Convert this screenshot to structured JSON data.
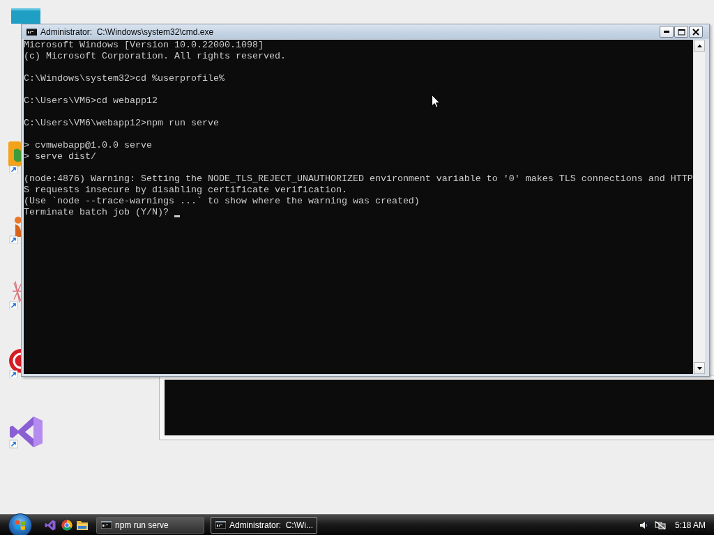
{
  "window": {
    "title": "Administrator:  C:\\Windows\\system32\\cmd.exe",
    "console": {
      "blocks": [
        [
          "Microsoft Windows [Version 10.0.22000.1098]",
          "(c) Microsoft Corporation. All rights reserved."
        ],
        [
          "C:\\Windows\\system32>cd %userprofile%"
        ],
        [
          "C:\\Users\\VM6>cd webapp12"
        ],
        [
          "C:\\Users\\VM6\\webapp12>npm run serve"
        ],
        [
          "> cvmwebapp@1.0.0 serve",
          "> serve dist/"
        ],
        [
          "(node:4876) Warning: Setting the NODE_TLS_REJECT_UNAUTHORIZED environment variable to '0' makes TLS connections and HTTP",
          "S requests insecure by disabling certificate verification.",
          "(Use `node --trace-warnings ...` to show where the warning was created)",
          "Terminate batch job (Y/N)?"
        ]
      ]
    }
  },
  "taskbar": {
    "tasks": [
      {
        "label": "npm run serve",
        "selected": false
      },
      {
        "label": "Administrator:  C:\\Wi...",
        "selected": true
      }
    ],
    "clock": "5:18 AM"
  }
}
